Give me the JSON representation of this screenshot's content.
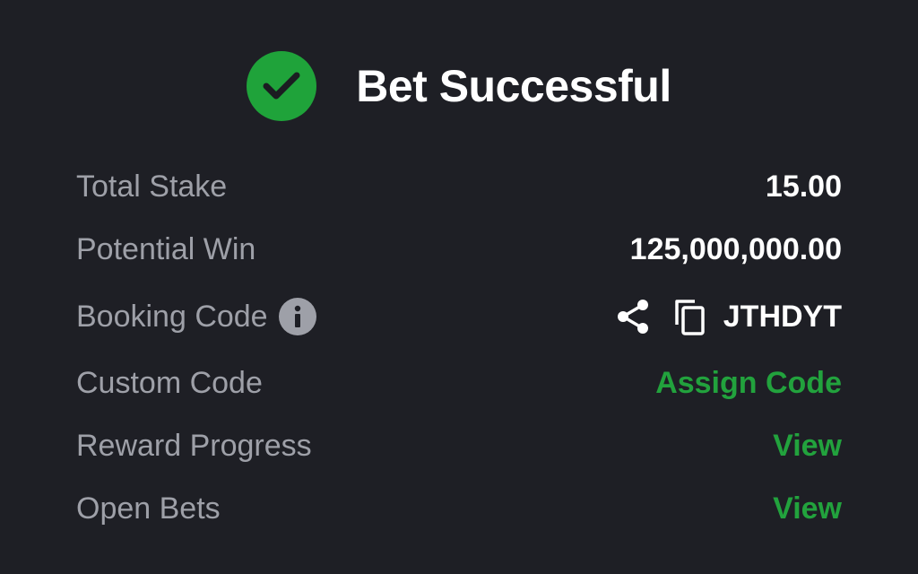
{
  "header": {
    "title": "Bet Successful",
    "icon": "check-circle-icon",
    "icon_color": "#1fa33a"
  },
  "rows": {
    "total_stake": {
      "label": "Total Stake",
      "value": "15.00"
    },
    "potential_win": {
      "label": "Potential Win",
      "value": "125,000,000.00"
    },
    "booking_code": {
      "label": "Booking Code",
      "info_icon": "info-icon",
      "share_icon": "share-icon",
      "copy_icon": "copy-icon",
      "value": "JTHDYT"
    },
    "custom_code": {
      "label": "Custom Code",
      "link": "Assign Code"
    },
    "reward_progress": {
      "label": "Reward Progress",
      "link": "View"
    },
    "open_bets": {
      "label": "Open Bets",
      "link": "View"
    }
  },
  "colors": {
    "background": "#1e1f25",
    "label": "#9ea0a8",
    "value": "#ffffff",
    "accent": "#22a23d"
  }
}
